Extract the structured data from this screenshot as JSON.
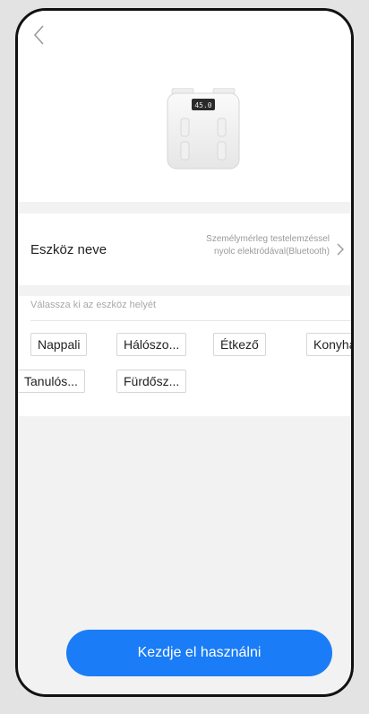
{
  "header": {
    "back_icon": "chevron-left-icon",
    "device_image": "body-scale-icon",
    "scale_display": "45.0"
  },
  "device": {
    "name_label": "Eszköz neve",
    "name_value_line1": "Személymérleg testelemzéssel",
    "name_value_line2": "nyolc elektródával(Bluetooth)",
    "chevron_icon": "chevron-right-icon"
  },
  "location": {
    "hint": "Válassza ki az eszköz helyét",
    "options": [
      "Nappali",
      "Hálószo...",
      "Étkező",
      "Konyha",
      "Tanulós...",
      "Fürdősz..."
    ]
  },
  "footer": {
    "start_label": "Kezdje el használni"
  },
  "colors": {
    "accent": "#1a7cf6",
    "background": "#f2f2f2",
    "frame": "#111111"
  }
}
